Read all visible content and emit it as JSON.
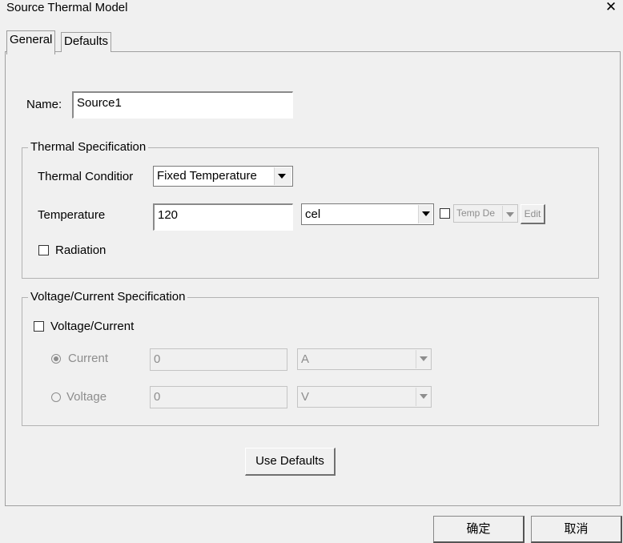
{
  "window": {
    "title": "Source Thermal Model",
    "close_glyph": "✕"
  },
  "tabs": [
    {
      "label": "General",
      "active": true
    },
    {
      "label": "Defaults",
      "active": false
    }
  ],
  "name_field": {
    "label": "Name:",
    "value": "Source1"
  },
  "thermal_spec": {
    "title": "Thermal Specification",
    "condition_label": "Thermal Conditior",
    "condition_value": "Fixed Temperature",
    "temperature_label": "Temperature",
    "temperature_value": "120",
    "temperature_unit": "cel",
    "temp_dep_value": "Temp De",
    "edit_label": "Edit",
    "radiation_label": "Radiation"
  },
  "voltage_spec": {
    "title": "Voltage/Current Specification",
    "checkbox_label": "Voltage/Current",
    "current_label": "Current",
    "current_value": "0",
    "current_unit": "A",
    "voltage_label": "Voltage",
    "voltage_value": "0",
    "voltage_unit": "V"
  },
  "use_defaults_label": "Use Defaults",
  "footer": {
    "ok_label": "确定",
    "cancel_label": "取消"
  }
}
